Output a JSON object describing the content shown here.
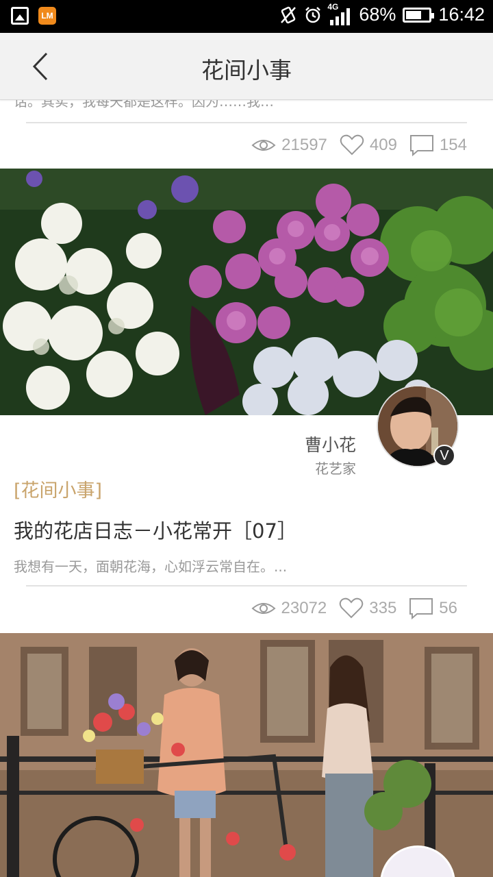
{
  "status_bar": {
    "icons_left": [
      "gallery-icon",
      "app-icon"
    ],
    "app_icon_text": "LM",
    "network": "4G",
    "battery_percent": "68%",
    "battery_level": 0.68,
    "time": "16:42"
  },
  "header": {
    "title": "花间小事",
    "back_icon": "chevron-left-icon"
  },
  "feed": {
    "prev_card": {
      "excerpt_cut": "话。其实，我每天都是这样。因为……我…",
      "stats": {
        "views": "21597",
        "likes": "409",
        "comments": "154"
      }
    },
    "card": {
      "author_name": "曹小花",
      "author_role": "花艺家",
      "verified_badge": "V",
      "category": "[花间小事]",
      "title": "我的花店日志－小花常开［07］",
      "excerpt": "我想有一天，面朝花海，心如浮云常自在。...",
      "stats": {
        "views": "23072",
        "likes": "335",
        "comments": "56"
      }
    }
  },
  "colors": {
    "accent": "#c9a46c",
    "header_bg": "#f2f2f2",
    "status_bg": "#000000"
  }
}
